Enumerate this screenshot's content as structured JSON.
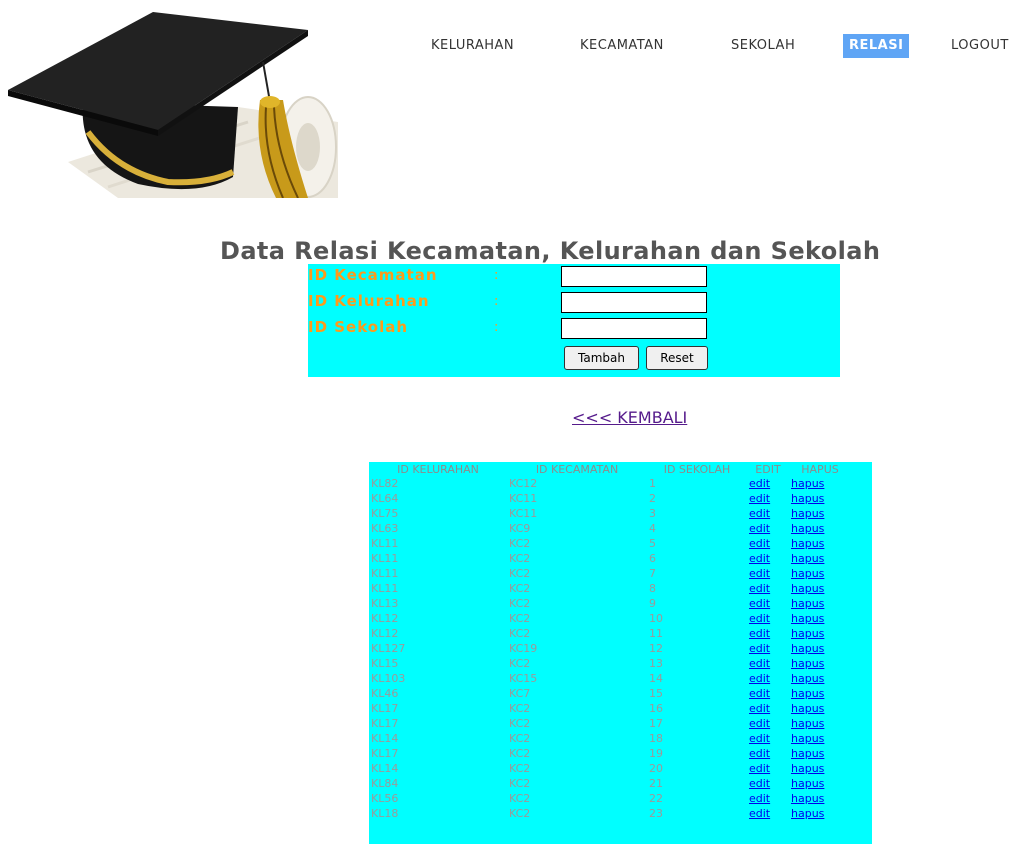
{
  "nav": {
    "items": [
      {
        "label": "KELURAHAN",
        "active": false
      },
      {
        "label": "KECAMATAN",
        "active": false
      },
      {
        "label": "SEKOLAH",
        "active": false
      },
      {
        "label": "RELASI",
        "active": true
      },
      {
        "label": "LOGOUT",
        "active": false
      }
    ],
    "active_color": "#5fa5f5"
  },
  "logo": {
    "icon": "graduation-cap-icon"
  },
  "page": {
    "title": "Data Relasi Kecamatan, Kelurahan dan Sekolah"
  },
  "form": {
    "background": "#00ffff",
    "label_color": "#ff9a1a",
    "fields": [
      {
        "label": "ID Kecamatan",
        "colon": ":",
        "value": ""
      },
      {
        "label": "ID Kelurahan",
        "colon": ":",
        "value": ""
      },
      {
        "label": "ID Sekolah",
        "colon": ":",
        "value": ""
      }
    ],
    "submit_label": "Tambah",
    "reset_label": "Reset"
  },
  "back_link": "<<< KEMBALI",
  "table": {
    "headers": [
      "ID KELURAHAN",
      "ID KECAMATAN",
      "ID SEKOLAH",
      "EDIT",
      "HAPUS"
    ],
    "rows": [
      [
        "KL82",
        "KC12",
        "1",
        "edit",
        "hapus"
      ],
      [
        "KL64",
        "KC11",
        "2",
        "edit",
        "hapus"
      ],
      [
        "KL75",
        "KC11",
        "3",
        "edit",
        "hapus"
      ],
      [
        "KL63",
        "KC9",
        "4",
        "edit",
        "hapus"
      ],
      [
        "KL11",
        "KC2",
        "5",
        "edit",
        "hapus"
      ],
      [
        "KL11",
        "KC2",
        "6",
        "edit",
        "hapus"
      ],
      [
        "KL11",
        "KC2",
        "7",
        "edit",
        "hapus"
      ],
      [
        "KL11",
        "KC2",
        "8",
        "edit",
        "hapus"
      ],
      [
        "KL13",
        "KC2",
        "9",
        "edit",
        "hapus"
      ],
      [
        "KL12",
        "KC2",
        "10",
        "edit",
        "hapus"
      ],
      [
        "KL12",
        "KC2",
        "11",
        "edit",
        "hapus"
      ],
      [
        "KL127",
        "KC19",
        "12",
        "edit",
        "hapus"
      ],
      [
        "KL15",
        "KC2",
        "13",
        "edit",
        "hapus"
      ],
      [
        "KL103",
        "KC15",
        "14",
        "edit",
        "hapus"
      ],
      [
        "KL46",
        "KC7",
        "15",
        "edit",
        "hapus"
      ],
      [
        "KL17",
        "KC2",
        "16",
        "edit",
        "hapus"
      ],
      [
        "KL17",
        "KC2",
        "17",
        "edit",
        "hapus"
      ],
      [
        "KL14",
        "KC2",
        "18",
        "edit",
        "hapus"
      ],
      [
        "KL17",
        "KC2",
        "19",
        "edit",
        "hapus"
      ],
      [
        "KL14",
        "KC2",
        "20",
        "edit",
        "hapus"
      ],
      [
        "KL84",
        "KC2",
        "21",
        "edit",
        "hapus"
      ],
      [
        "KL56",
        "KC2",
        "22",
        "edit",
        "hapus"
      ],
      [
        "KL18",
        "KC2",
        "23",
        "edit",
        "hapus"
      ]
    ]
  }
}
